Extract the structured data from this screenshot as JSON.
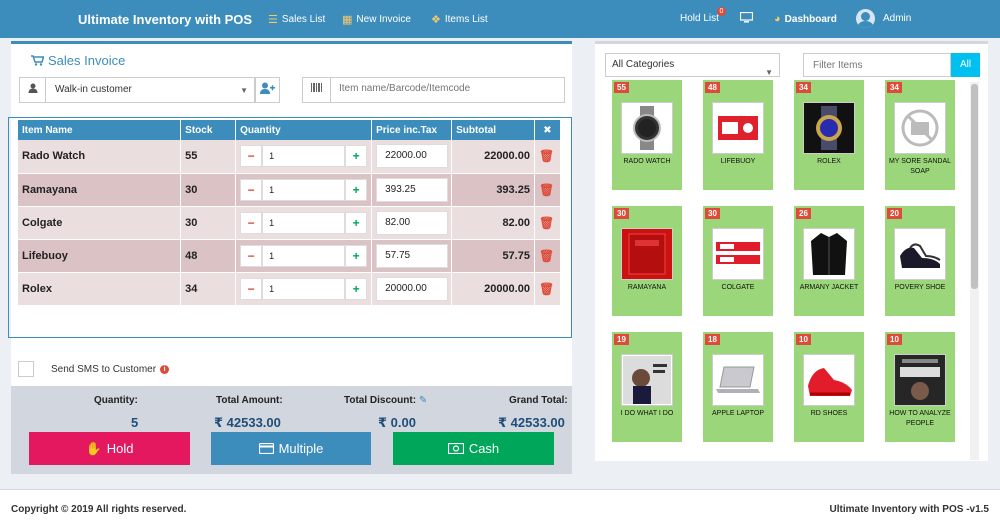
{
  "navbar": {
    "brand": "Ultimate Inventory with POS",
    "sales_list": "Sales List",
    "new_invoice": "New Invoice",
    "items_list": "Items List",
    "hold_list": "Hold List",
    "hold_count": "0",
    "dashboard": "Dashboard",
    "user": "Admin"
  },
  "invoice": {
    "title": "Sales Invoice",
    "customer": "Walk-in customer",
    "barcode_placeholder": "Item name/Barcode/Itemcode",
    "columns": [
      "Item Name",
      "Stock",
      "Quantity",
      "Price inc.Tax",
      "Subtotal",
      "✖"
    ],
    "rows": [
      {
        "name": "Rado Watch",
        "stock": "55",
        "qty": "1",
        "price": "22000.00",
        "subtotal": "22000.00"
      },
      {
        "name": "Ramayana",
        "stock": "30",
        "qty": "1",
        "price": "393.25",
        "subtotal": "393.25"
      },
      {
        "name": "Colgate",
        "stock": "30",
        "qty": "1",
        "price": "82.00",
        "subtotal": "82.00"
      },
      {
        "name": "Lifebuoy",
        "stock": "48",
        "qty": "1",
        "price": "57.75",
        "subtotal": "57.75"
      },
      {
        "name": "Rolex",
        "stock": "34",
        "qty": "1",
        "price": "20000.00",
        "subtotal": "20000.00"
      }
    ],
    "sms_label": "Send SMS to Customer"
  },
  "totals": {
    "quantity_label": "Quantity:",
    "quantity": "5",
    "amount_label": "Total Amount:",
    "amount": "₹ 42533.00",
    "discount_label": "Total Discount:",
    "discount": "₹ 0.00",
    "grand_label": "Grand Total:",
    "grand": "₹ 42533.00"
  },
  "buttons": {
    "hold": "Hold",
    "multiple": "Multiple",
    "cash": "Cash"
  },
  "catalog": {
    "category": "All Categories",
    "filter_placeholder": "Filter Items",
    "all": "All",
    "items": [
      {
        "stock": "55",
        "name": "RADO WATCH",
        "icon": "watch-icon"
      },
      {
        "stock": "48",
        "name": "LIFEBUOY",
        "icon": "soap-box-icon"
      },
      {
        "stock": "34",
        "name": "ROLEX",
        "icon": "watch-icon"
      },
      {
        "stock": "34",
        "name": "MY SORE SANDAL SOAP",
        "icon": "no-image-icon"
      },
      {
        "stock": "30",
        "name": "RAMAYANA",
        "icon": "book-icon"
      },
      {
        "stock": "30",
        "name": "COLGATE",
        "icon": "toothpaste-icon"
      },
      {
        "stock": "26",
        "name": "ARMANY JACKET",
        "icon": "jacket-icon"
      },
      {
        "stock": "20",
        "name": "POVERY SHOE",
        "icon": "shoe-icon"
      },
      {
        "stock": "19",
        "name": "I DO WHAT I DO",
        "icon": "book-icon"
      },
      {
        "stock": "18",
        "name": "APPLE LAPTOP",
        "icon": "laptop-icon"
      },
      {
        "stock": "10",
        "name": "RD SHOES",
        "icon": "shoe-icon"
      },
      {
        "stock": "10",
        "name": "HOW TO ANALYZE PEOPLE",
        "icon": "book-icon"
      }
    ]
  },
  "footer": {
    "copyright": "Copyright © 2019 All rights reserved.",
    "version": "Ultimate Inventory with POS -v1.5"
  }
}
